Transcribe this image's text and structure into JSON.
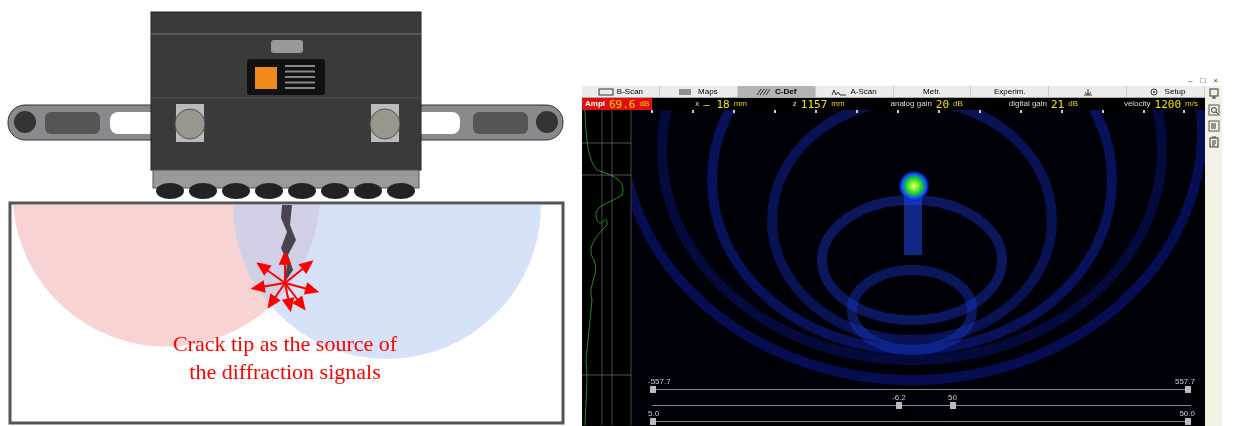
{
  "diagram": {
    "caption": [
      "Crack tip as the source of",
      "the diffraction signals"
    ]
  },
  "app": {
    "window_controls": [
      "–",
      "□",
      "×"
    ],
    "tabs": [
      {
        "label": "B-Scan",
        "selected": false
      },
      {
        "label": "Maps",
        "selected": false
      },
      {
        "label": "C-Def",
        "selected": true
      },
      {
        "label": "A-Scan",
        "selected": false
      },
      {
        "label": "Metr.",
        "selected": false
      },
      {
        "label": "Experim.",
        "selected": false
      },
      {
        "kind": "icon",
        "selected": false
      },
      {
        "label": "Setup",
        "selected": false
      }
    ],
    "readings": [
      {
        "kind": "alarm",
        "label": "Ampl",
        "value": "69.6",
        "unit": "dB"
      },
      {
        "label": "x",
        "value": "– 18",
        "unit": "mm"
      },
      {
        "label": "z",
        "value": "1157",
        "unit": "mm"
      },
      {
        "label": "analog gain",
        "value": "20",
        "unit": "dB"
      },
      {
        "label": "digital gain",
        "value": "21",
        "unit": "dB"
      },
      {
        "label": "velocity",
        "value": "1200",
        "unit": "m/s"
      }
    ],
    "range_sliders": [
      {
        "min": "-557.7",
        "max": "557.7"
      },
      {
        "min": "-6.2",
        "max": "50"
      },
      {
        "min": "5.0",
        "max": "50.0"
      }
    ]
  }
}
